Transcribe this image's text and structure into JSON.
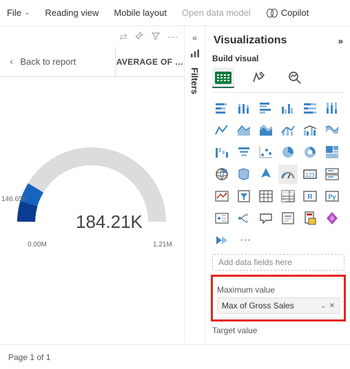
{
  "menubar": {
    "file": "File",
    "reading_view": "Reading view",
    "mobile_layout": "Mobile layout",
    "open_data_model": "Open data model",
    "copilot": "Copilot"
  },
  "canvas": {
    "back": "Back to report",
    "header": "AVERAGE OF …"
  },
  "gauge": {
    "value": "184.21K",
    "left_label": "146.65K",
    "min": "0.00M",
    "max": "1.21M"
  },
  "filters_tab": "Filters",
  "viz": {
    "title": "Visualizations",
    "build": "Build visual",
    "add_fields": "Add data fields here",
    "max_label": "Maximum value",
    "max_field": "Max of Gross Sales",
    "target_label": "Target value",
    "more": "···"
  },
  "footer": {
    "page": "Page 1 of 1"
  },
  "chart_data": {
    "type": "gauge",
    "title": "AVERAGE OF …",
    "value": 184210,
    "value_display": "184.21K",
    "min": 0,
    "min_display": "0.00M",
    "max": 1210000,
    "max_display": "1.21M",
    "marker": 146650,
    "marker_display": "146.65K"
  }
}
